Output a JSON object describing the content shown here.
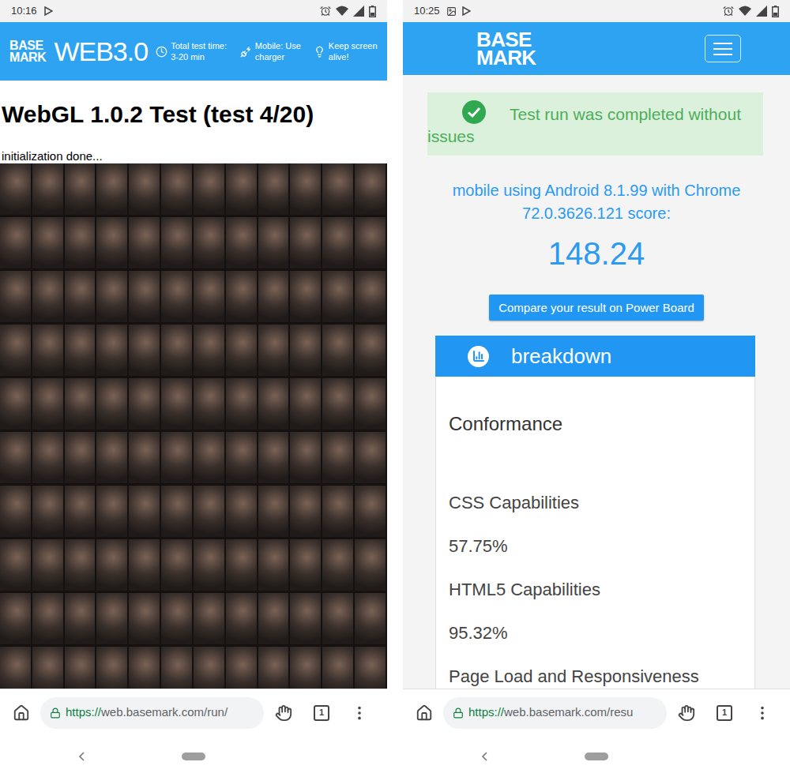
{
  "left_screen": {
    "status_bar": {
      "time": "10:16"
    },
    "header": {
      "logo": [
        "BASE",
        "MARK"
      ],
      "product": "WEB3.0",
      "tips": [
        "Total test time: 3-20 min",
        "Mobile: Use charger",
        "Keep screen alive!"
      ]
    },
    "title": "WebGL 1.0.2 Test (test 4/20)",
    "status": "initialization done...",
    "browser": {
      "url_scheme": "https://",
      "url_rest": "web.basemark.com/run/",
      "tab_count": "1"
    }
  },
  "right_screen": {
    "status_bar": {
      "time": "10:25"
    },
    "header": {
      "logo": [
        "BASE",
        "MARK"
      ]
    },
    "alert": "Test run was completed without issues",
    "device": "mobile using Android 8.1.99 with Chrome 72.0.3626.121 score:",
    "score": "148.24",
    "compare_button": "Compare your result on Power Board",
    "breakdown": {
      "title": "breakdown",
      "section": "Conformance",
      "items": [
        {
          "label": "CSS Capabilities",
          "value": "57.75%"
        },
        {
          "label": "HTML5 Capabilities",
          "value": "95.32%"
        },
        {
          "label": "Page Load and Responsiveness",
          "value": ""
        }
      ]
    },
    "browser": {
      "url_scheme": "https://",
      "url_rest": "web.basemark.com/resu",
      "tab_count": "1"
    }
  }
}
